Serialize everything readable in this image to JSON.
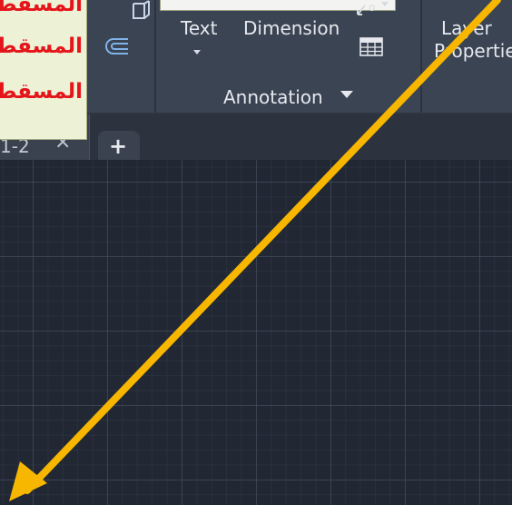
{
  "ribbon": {
    "buttons": {
      "text": {
        "label": "Text",
        "icon": "text-icon",
        "has_dropdown": true
      },
      "dimension": {
        "label": "Dimension",
        "icon": "dimension-icon"
      },
      "layer_properties": {
        "label_line1": "Layer",
        "label_line2": "Properties",
        "icon": "layer-properties-icon"
      }
    },
    "panel_title": "Annotation",
    "small_tools": [
      {
        "icon": "box-3d-icon"
      },
      {
        "icon": "offset-icon"
      },
      {
        "icon": "table-icon"
      },
      {
        "icon": "leader-icon"
      }
    ]
  },
  "tabs": {
    "file_tab_label": "1-2",
    "close_glyph": "×",
    "new_tab_glyph": "+"
  },
  "note": {
    "lines": [
      "المسقط",
      "المسقط",
      "المسقط"
    ],
    "color": "#e4161b",
    "background": "#edf1d6"
  },
  "annotation_arrow": {
    "color": "#f7b600",
    "direction": "down-left"
  },
  "colors": {
    "ribbon_bg": "#3b4453",
    "canvas_bg": "#212733",
    "tabbar_bg": "#2c323e"
  }
}
